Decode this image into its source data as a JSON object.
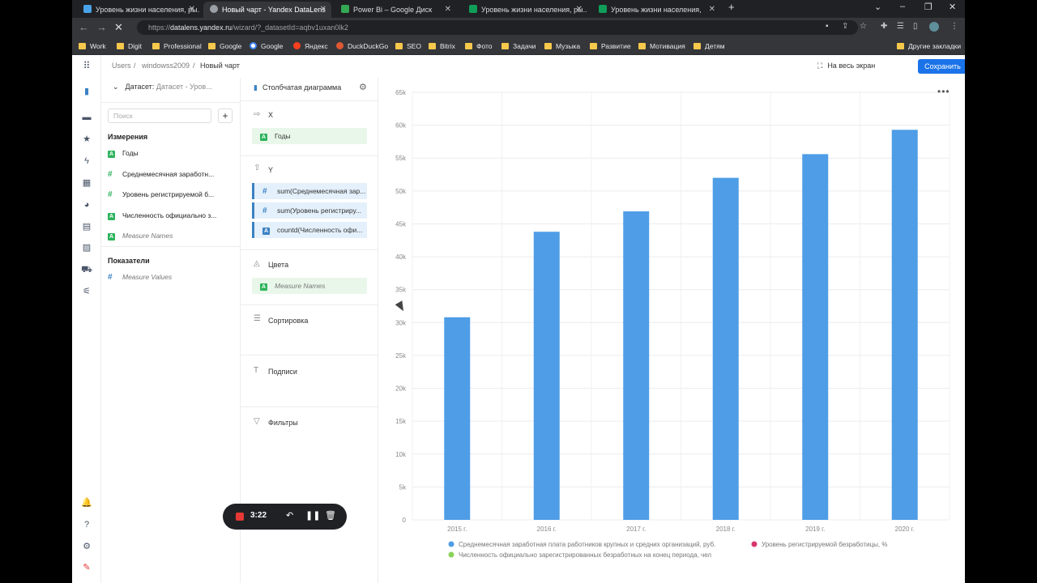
{
  "browser": {
    "tabs": [
      {
        "label": "Уровень жизни населения, ры...",
        "color": "#4aa3e8"
      },
      {
        "label": "Новый чарт - Yandex DataLens",
        "color": "#9aa0a6",
        "active": true
      },
      {
        "label": "Power Bi – Google Диск",
        "color": "#34a853"
      },
      {
        "label": "Уровень жизни населения, ры...",
        "color": "#0f9d58"
      },
      {
        "label": "Уровень жизни населения,",
        "color": "#0f9d58"
      }
    ],
    "url_prefix": "https://",
    "url_host": "datalens.yandex.ru",
    "url_path": "/wizard/?_datasetId=aqbv1uxan0lk2",
    "bookmarks": [
      "Work",
      "Digit",
      "Professional",
      "Google",
      "Google",
      "Яндекс",
      "DuckDuckGo",
      "SEO",
      "Bitrix",
      "Фото",
      "Задачи",
      "Музыка",
      "Развитие",
      "Мотивация",
      "Детям"
    ],
    "other_bookmarks": "Другие закладки"
  },
  "header": {
    "breadcrumbs": [
      "Users",
      "windowss2009",
      "Новый чарт"
    ],
    "fullscreen": "На весь экран",
    "save": "Сохранить"
  },
  "dataset": {
    "label": "Датасет:",
    "name": "Датасет - Уров...",
    "search_placeholder": "Поиск",
    "dimensions_title": "Измерения",
    "dimensions": [
      {
        "type": "A",
        "label": "Годы"
      },
      {
        "type": "#",
        "label": "Среднемесячная заработн..."
      },
      {
        "type": "#",
        "label": "Уровень регистрируемой б..."
      },
      {
        "type": "A",
        "label": "Численность официально з..."
      },
      {
        "type": "A",
        "label": "Measure Names",
        "italic": true
      }
    ],
    "measures_title": "Показатели",
    "measures": [
      {
        "type": "#",
        "label": "Measure Values",
        "italic": true
      }
    ]
  },
  "wizard": {
    "chart_type": "Столбчатая диаграмма",
    "x_label": "X",
    "x_field": "Годы",
    "y_label": "Y",
    "y_fields": [
      "sum(Среднемесячная зар...",
      "sum(Уровень регистриру...",
      "countd(Численность офи..."
    ],
    "colors_label": "Цвета",
    "colors_field": "Measure Names",
    "sort_label": "Сортировка",
    "labels_label": "Подписи",
    "filters_label": "Фильтры"
  },
  "chart_data": {
    "type": "bar",
    "categories": [
      "2015 г.",
      "2016 г.",
      "2017 г.",
      "2018 г.",
      "2019 г.",
      "2020 г."
    ],
    "series": [
      {
        "name": "Среднемесячная заработная плата работников крупных и средних организаций, руб.",
        "color": "#4e9de6",
        "values": [
          30800,
          43800,
          46900,
          52000,
          55600,
          59300
        ]
      }
    ],
    "legend": [
      {
        "name": "Среднемесячная заработная плата работников крупных и средних организаций, руб.",
        "color": "#4e9de6"
      },
      {
        "name": "Уровень регистрируемой безработицы, %",
        "color": "#d8356e"
      },
      {
        "name": "Численность официально зарегистрированных безработных на конец периода, чел",
        "color": "#8bd15a"
      }
    ],
    "yticks": [
      "0",
      "5k",
      "10k",
      "15k",
      "20k",
      "25k",
      "30k",
      "35k",
      "40k",
      "45k",
      "50k",
      "55k",
      "60k",
      "65k"
    ],
    "ylim": [
      0,
      65000
    ],
    "grid": true,
    "legend_position": "bottom"
  },
  "recorder": {
    "time": "3:22"
  }
}
